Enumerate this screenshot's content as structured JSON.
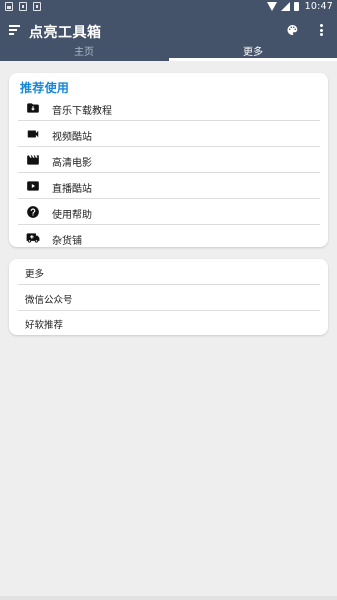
{
  "status_bar": {
    "time": "10:47",
    "left_icons": [
      "image-notification-icon",
      "bag-notification-icon",
      "app-notification-icon"
    ],
    "right_icons": [
      "wifi-icon",
      "signal-icon",
      "battery-icon"
    ]
  },
  "app_bar": {
    "title": "点亮工具箱",
    "background_color": "#44526a"
  },
  "tabs": [
    {
      "label": "主页",
      "selected": false
    },
    {
      "label": "更多",
      "selected": true
    }
  ],
  "recommend": {
    "title": "推荐使用",
    "accent_color": "#1787d8",
    "items": [
      {
        "label": "音乐下载教程",
        "icon": "folder-download-icon"
      },
      {
        "label": "视频酷站",
        "icon": "videocam-icon"
      },
      {
        "label": "高清电影",
        "icon": "movie-clapper-icon"
      },
      {
        "label": "直播酷站",
        "icon": "play-box-icon"
      },
      {
        "label": "使用帮助",
        "icon": "help-circle-icon"
      },
      {
        "label": "杂货铺",
        "icon": "truck-icon"
      }
    ]
  },
  "more_list": {
    "items": [
      {
        "label": "更多"
      },
      {
        "label": "微信公众号"
      },
      {
        "label": "好软推荐"
      }
    ]
  }
}
